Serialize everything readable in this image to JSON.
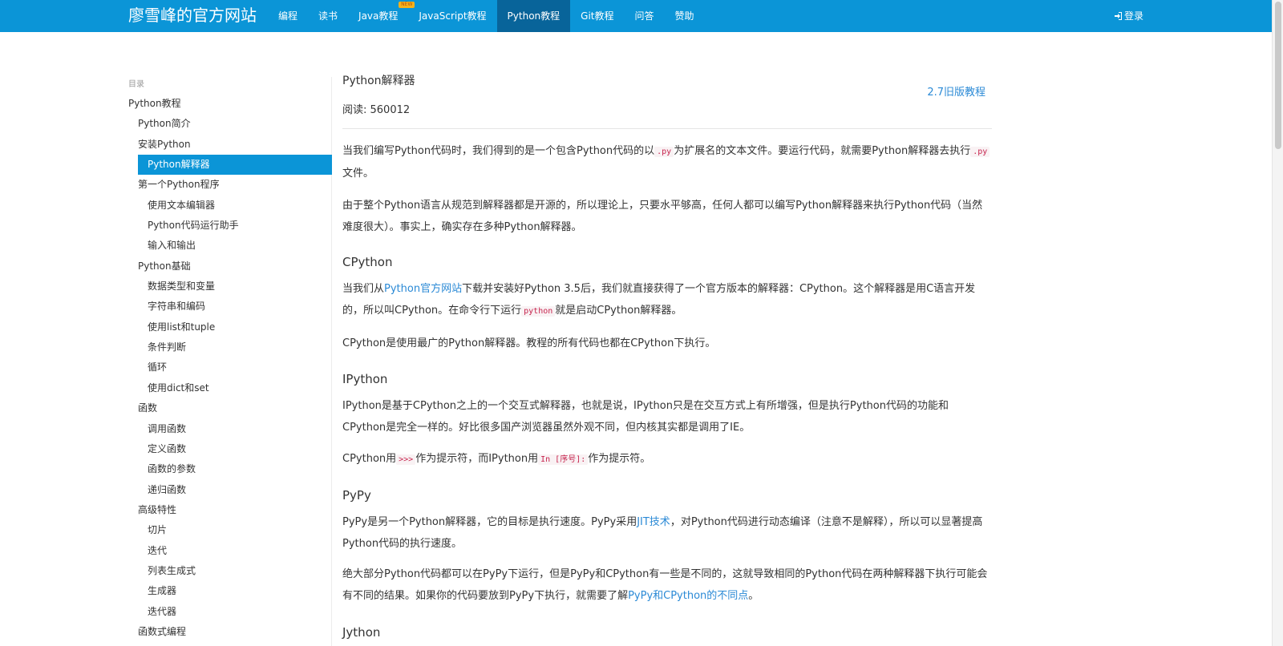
{
  "navbar": {
    "brand": "廖雪峰的官方网站",
    "items": [
      {
        "label": "编程"
      },
      {
        "label": "读书"
      },
      {
        "label": "Java教程",
        "badge": "NEW"
      },
      {
        "label": "JavaScript教程"
      },
      {
        "label": "Python教程",
        "active": true
      },
      {
        "label": "Git教程"
      },
      {
        "label": "问答"
      },
      {
        "label": "赞助"
      }
    ],
    "login_label": "登录",
    "login_icon": "sign-in-icon"
  },
  "sidebar": {
    "label": "目录",
    "items": [
      {
        "label": "Python教程",
        "level": 0
      },
      {
        "label": "Python简介",
        "level": 1
      },
      {
        "label": "安装Python",
        "level": 1
      },
      {
        "label": "Python解释器",
        "level": 2,
        "active": true
      },
      {
        "label": "第一个Python程序",
        "level": 1
      },
      {
        "label": "使用文本编辑器",
        "level": 2
      },
      {
        "label": "Python代码运行助手",
        "level": 2
      },
      {
        "label": "输入和输出",
        "level": 2
      },
      {
        "label": "Python基础",
        "level": 1
      },
      {
        "label": "数据类型和变量",
        "level": 2
      },
      {
        "label": "字符串和编码",
        "level": 2
      },
      {
        "label": "使用list和tuple",
        "level": 2
      },
      {
        "label": "条件判断",
        "level": 2
      },
      {
        "label": "循环",
        "level": 2
      },
      {
        "label": "使用dict和set",
        "level": 2
      },
      {
        "label": "函数",
        "level": 1
      },
      {
        "label": "调用函数",
        "level": 2
      },
      {
        "label": "定义函数",
        "level": 2
      },
      {
        "label": "函数的参数",
        "level": 2
      },
      {
        "label": "递归函数",
        "level": 2
      },
      {
        "label": "高级特性",
        "level": 1
      },
      {
        "label": "切片",
        "level": 2
      },
      {
        "label": "迭代",
        "level": 2
      },
      {
        "label": "列表生成式",
        "level": 2
      },
      {
        "label": "生成器",
        "level": 2
      },
      {
        "label": "迭代器",
        "level": 2
      },
      {
        "label": "函数式编程",
        "level": 1
      }
    ]
  },
  "main": {
    "title": "Python解释器",
    "reads_label": "阅读: ",
    "reads_count": "560012",
    "old_version_link": "2.7旧版教程",
    "p1": {
      "a": "当我们编写Python代码时，我们得到的是一个包含Python代码的以",
      "code1": ".py",
      "b": "为扩展名的文本文件。要运行代码，就需要Python解释器去执行",
      "code2": ".py",
      "c": "文件。"
    },
    "p2": "由于整个Python语言从规范到解释器都是开源的，所以理论上，只要水平够高，任何人都可以编写Python解释器来执行Python代码（当然难度很大）。事实上，确实存在多种Python解释器。",
    "h_cpython": "CPython",
    "p3": {
      "a": "当我们从",
      "link": "Python官方网站",
      "b": "下载并安装好Python 3.5后，我们就直接获得了一个官方版本的解释器：CPython。这个解释器是用C语言开发的，所以叫CPython。在命令行下运行",
      "code": "python",
      "c": "就是启动CPython解释器。"
    },
    "p4": "CPython是使用最广的Python解释器。教程的所有代码也都在CPython下执行。",
    "h_ipython": "IPython",
    "p5": "IPython是基于CPython之上的一个交互式解释器，也就是说，IPython只是在交互方式上有所增强，但是执行Python代码的功能和CPython是完全一样的。好比很多国产浏览器虽然外观不同，但内核其实都是调用了IE。",
    "p6": {
      "a": "CPython用",
      "code1": ">>>",
      "b": "作为提示符，而IPython用",
      "code2": "In [序号]:",
      "c": "作为提示符。"
    },
    "h_pypy": "PyPy",
    "p7": {
      "a": "PyPy是另一个Python解释器，它的目标是执行速度。PyPy采用",
      "link": "JIT技术",
      "b": "，对Python代码进行动态编译（注意不是解释），所以可以显著提高Python代码的执行速度。"
    },
    "p8": {
      "a": "绝大部分Python代码都可以在PyPy下运行，但是PyPy和CPython有一些是不同的，这就导致相同的Python代码在两种解释器下执行可能会有不同的结果。如果你的代码要放到PyPy下执行，就需要了解",
      "link": "PyPy和CPython的不同点",
      "b": "。"
    },
    "h_jython": "Jython"
  }
}
